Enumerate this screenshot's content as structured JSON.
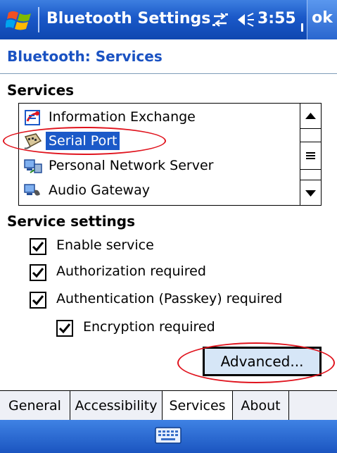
{
  "titlebar": {
    "title": "Bluetooth Settings",
    "time": "3:55",
    "ok_label": "ok",
    "icons": [
      "windows-start-icon",
      "connectivity-icon",
      "volume-icon"
    ]
  },
  "page": {
    "header": "Bluetooth: Services"
  },
  "services": {
    "title": "Services",
    "items": [
      {
        "label": "Information Exchange",
        "icon": "information-exchange-icon",
        "selected": false
      },
      {
        "label": "Serial Port",
        "icon": "serial-port-icon",
        "selected": true
      },
      {
        "label": "Personal Network Server",
        "icon": "network-server-icon",
        "selected": false
      },
      {
        "label": "Audio Gateway",
        "icon": "audio-gateway-icon",
        "selected": false
      }
    ]
  },
  "settings": {
    "title": "Service settings",
    "options": [
      {
        "label": "Enable service",
        "checked": true
      },
      {
        "label": "Authorization required",
        "checked": true
      },
      {
        "label": "Authentication (Passkey) required",
        "checked": true
      },
      {
        "label": "Encryption required",
        "checked": true
      }
    ],
    "advanced_label": "Advanced..."
  },
  "tabs": [
    {
      "label": "General",
      "active": false
    },
    {
      "label": "Accessibility",
      "active": false
    },
    {
      "label": "Services",
      "active": true
    },
    {
      "label": "About",
      "active": false
    }
  ],
  "menubar": {
    "icon": "keyboard-icon"
  },
  "colors": {
    "titlebar": "#1a58c8",
    "header_text": "#1a52c2",
    "selection": "#1b59c8",
    "advanced_button": "#d6e6f7",
    "highlight_ellipse": "#e0141e"
  }
}
